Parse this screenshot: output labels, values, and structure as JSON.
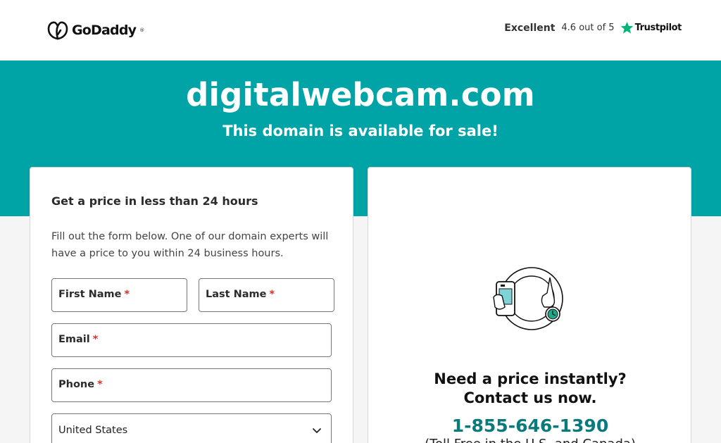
{
  "header": {
    "logo_text": "GoDaddy",
    "logo_tm": "®",
    "trust_rating_label": "Excellent",
    "trust_score": "4.6 out of 5",
    "trust_brand": "Trustpilot"
  },
  "hero": {
    "domain": "digitalwebcam.com",
    "tagline": "This domain is available for sale!"
  },
  "form": {
    "title": "Get a price in less than 24 hours",
    "description": "Fill out the form below. One of our domain experts will have a price to you within 24 business hours.",
    "first_name_label": "First Name",
    "last_name_label": "Last Name",
    "email_label": "Email",
    "phone_label": "Phone",
    "required_marker": "*",
    "country_value": "United States"
  },
  "contact": {
    "heading_line1": "Need a price instantly?",
    "heading_line2": "Contact us now.",
    "phone": "1-855-646-1390",
    "toll_free_note": "(Toll Free in the U.S. and Canada)"
  },
  "colors": {
    "brand_teal": "#00a4a6",
    "phone_teal": "#0b7a7c",
    "trustpilot_green": "#00b67a",
    "required_red": "#d4332a"
  }
}
